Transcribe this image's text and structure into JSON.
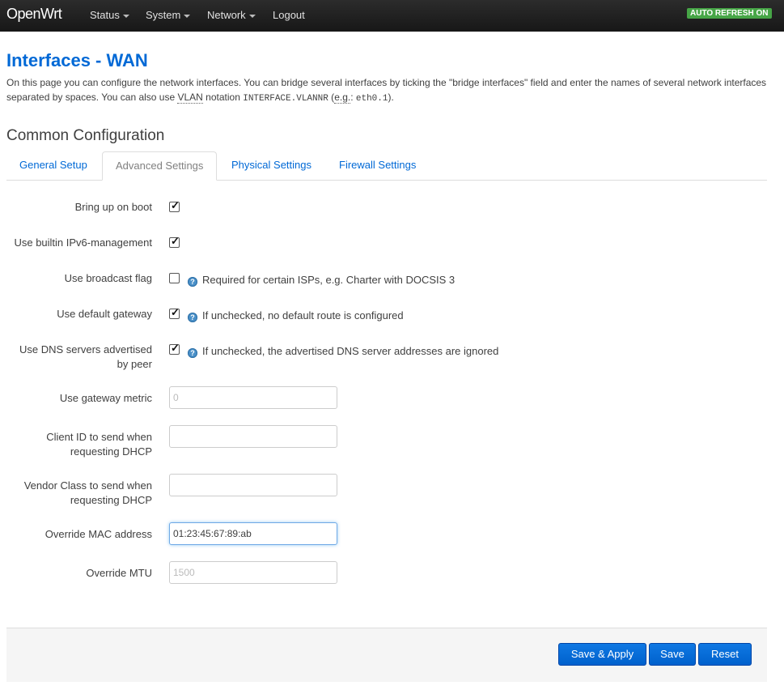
{
  "navbar": {
    "brand": "OpenWrt",
    "items": [
      {
        "label": "Status",
        "dropdown": true
      },
      {
        "label": "System",
        "dropdown": true
      },
      {
        "label": "Network",
        "dropdown": true
      },
      {
        "label": "Logout",
        "dropdown": false
      }
    ],
    "auto_refresh": "AUTO REFRESH ON"
  },
  "page": {
    "title": "Interfaces - WAN",
    "description_1": "On this page you can configure the network interfaces. You can bridge several interfaces by ticking the \"bridge interfaces\" field and enter the names of several network interfaces separated by spaces. You can also use ",
    "vlan": "VLAN",
    "description_2": " notation ",
    "notation": "INTERFACE.VLANNR",
    "description_3": " (",
    "eg": "e.g.",
    "description_4": ": ",
    "example": "eth0.1",
    "description_5": ")."
  },
  "section": {
    "title": "Common Configuration",
    "tabs": [
      "General Setup",
      "Advanced Settings",
      "Physical Settings",
      "Firewall Settings"
    ],
    "active_tab": "Advanced Settings"
  },
  "form": {
    "bring_up_on_boot": {
      "label": "Bring up on boot",
      "checked": true
    },
    "ipv6_management": {
      "label": "Use builtin IPv6-management",
      "checked": true
    },
    "broadcast_flag": {
      "label": "Use broadcast flag",
      "checked": false,
      "help": "Required for certain ISPs, e.g. Charter with DOCSIS 3"
    },
    "default_gateway": {
      "label": "Use default gateway",
      "checked": true,
      "help": "If unchecked, no default route is configured"
    },
    "peer_dns": {
      "label_line1": "Use DNS servers advertised",
      "label_line2": "by peer",
      "checked": true,
      "help": "If unchecked, the advertised DNS server addresses are ignored"
    },
    "gateway_metric": {
      "label": "Use gateway metric",
      "placeholder": "0",
      "value": ""
    },
    "client_id": {
      "label_line1": "Client ID to send when",
      "label_line2": "requesting DHCP",
      "value": ""
    },
    "vendor_class": {
      "label_line1": "Vendor Class to send when",
      "label_line2": "requesting DHCP",
      "value": ""
    },
    "mac_address": {
      "label": "Override MAC address",
      "value": "01:23:45:67:89:ab"
    },
    "mtu": {
      "label": "Override MTU",
      "placeholder": "1500",
      "value": ""
    }
  },
  "actions": {
    "save_apply": "Save & Apply",
    "save": "Save",
    "reset": "Reset"
  },
  "colors": {
    "accent": "#0069d6",
    "navbar": "#222222",
    "refresh_badge": "#46a546",
    "button": "#0069d6"
  }
}
